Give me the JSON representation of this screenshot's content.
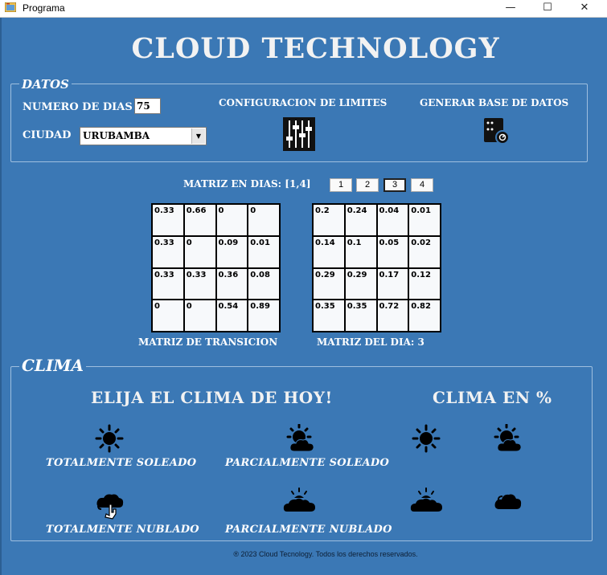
{
  "window": {
    "title": "Programa",
    "minimize": "—",
    "maximize": "☐",
    "close": "✕"
  },
  "heading": "CLOUD TECHNOLOGY",
  "datos": {
    "legend": "DATOS",
    "numero_dias_label": "NUMERO DE DIAS",
    "numero_dias_value": "75",
    "ciudad_label": "CIUDAD",
    "ciudad_value": "URUBAMBA",
    "config_label": "CONFIGURACION DE LIMITES",
    "generar_label": "GENERAR BASE DE DATOS",
    "config_icon": "sliders-icon",
    "generar_icon": "database-settings-icon"
  },
  "matriz": {
    "label": "MATRIZ EN DIAS: [1,4]",
    "day_buttons": [
      "1",
      "2",
      "3",
      "4"
    ],
    "selected_day": "3",
    "transicion_label": "MATRIZ DE TRANSICION",
    "dia_label": "MATRIZ DEL DIA: 3",
    "transicion": [
      [
        "0.33",
        "0.66",
        "0",
        "0"
      ],
      [
        "0.33",
        "0",
        "0.09",
        "0.01"
      ],
      [
        "0.33",
        "0.33",
        "0.36",
        "0.08"
      ],
      [
        "0",
        "0",
        "0.54",
        "0.89"
      ]
    ],
    "dia": [
      [
        "0.2",
        "0.24",
        "0.04",
        "0.01"
      ],
      [
        "0.14",
        "0.1",
        "0.05",
        "0.02"
      ],
      [
        "0.29",
        "0.29",
        "0.17",
        "0.12"
      ],
      [
        "0.35",
        "0.35",
        "0.72",
        "0.82"
      ]
    ]
  },
  "clima": {
    "legend": "CLIMA",
    "elija": "ELIJA EL CLIMA DE HOY!",
    "clima_pct": "CLIMA EN %",
    "options": [
      {
        "label": "TOTALMENTE SOLEADO",
        "icon": "sun-icon"
      },
      {
        "label": "PARCIALMENTE SOLEADO",
        "icon": "sun-behind-cloud-icon"
      },
      {
        "label": "TOTALMENTE NUBLADO",
        "icon": "clouds-icon"
      },
      {
        "label": "PARCIALMENTE NUBLADO",
        "icon": "cloud-with-sun-icon"
      }
    ]
  },
  "footer": "® 2023 Cloud Tecnology. Todos los derechos reservados.",
  "colors": {
    "background": "#3b78b5",
    "border": "#9fbfdf",
    "text": "#ffffff"
  }
}
